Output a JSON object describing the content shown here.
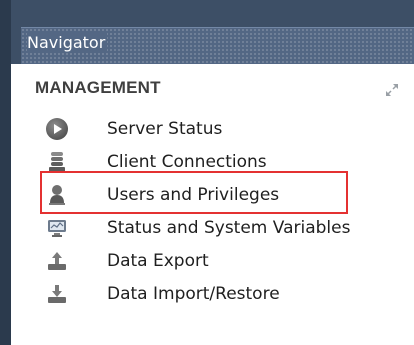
{
  "navigator": {
    "title": "Navigator"
  },
  "section": {
    "title": "MANAGEMENT"
  },
  "items": [
    {
      "label": "Server Status",
      "icon": "server-status-icon"
    },
    {
      "label": "Client Connections",
      "icon": "client-connections-icon"
    },
    {
      "label": "Users and Privileges",
      "icon": "users-privileges-icon"
    },
    {
      "label": "Status and System Variables",
      "icon": "status-system-variables-icon"
    },
    {
      "label": "Data Export",
      "icon": "data-export-icon"
    },
    {
      "label": "Data Import/Restore",
      "icon": "data-import-restore-icon"
    }
  ],
  "colors": {
    "header": "#536784",
    "frame": "#2b3a4d",
    "highlight": "#e43131"
  }
}
